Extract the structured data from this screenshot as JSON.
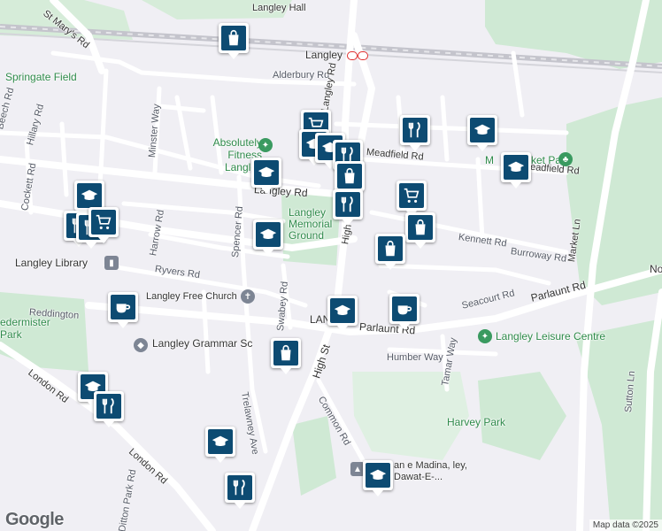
{
  "map": {
    "labels": {
      "langley_hall": "Langley Hall",
      "st_marys_rd": "St Mary's Rd",
      "langley_station": "Langley",
      "alderbury_rd": "Alderbury Rd",
      "springate_field": "Springate Field",
      "beech_rd": "Beech Rd",
      "hillary_rd": "Hillary Rd",
      "minster_way": "Minster Way",
      "langley_rd_v": "Langley Rd",
      "absolutely_fitness": "Absolutely Fitness Langley",
      "langley_rd_h": "Langley Rd",
      "cockett_rd": "Cockett Rd",
      "harrow_rd": "Harrow Rd",
      "spencer_rd": "Spencer Rd",
      "langley_memorial": "Langley Memorial Ground",
      "high_st_n": "High",
      "headfield_rd_1": "Meadfield Rd",
      "headfield_rd_2": "Meadfield Rd",
      "market_ln": "Market Ln",
      "kennett_rd": "Kennett Rd",
      "burroway_rd": "Burroway Rd",
      "langley_library": "Langley Library",
      "ryvers_rd": "Ryvers Rd",
      "free_church": "Langley Free Church",
      "swabey_rd": "Swabey Rd",
      "seacourt_rd": "Seacourt Rd",
      "parlaunt_rd": "Parlaunt Rd",
      "parlaunt_rd2": "Parlaunt Rd",
      "no": "No",
      "reddington": "Reddington",
      "upton_park": "edermister Park",
      "langley_grammar": "Langley Grammar Sc",
      "high_st_s": "High St",
      "langley_leisure": "Langley Leisure Centre",
      "humber_way": "Humber Way",
      "tamar_way": "Tamar Way",
      "london_rd_1": "London Rd",
      "london_rd_2": "London Rd",
      "trelawney_ave": "Trelawney Ave",
      "common_rd": "Common Rd",
      "harvey_park": "Harvey Park",
      "sutton_ln": "Sutton Ln",
      "mosque": "an e Madina, ley, Dawat-E-...",
      "ditton_park": "Ditton Park Rd",
      "market_park": "M",
      "market_park2": "ket Park",
      "langley_parlaunt": "LAN"
    },
    "google_logo": "Google",
    "attribution": "Map data ©2025",
    "pins": [
      {
        "icon": "shopping-bag",
        "name": "pin-shopping-1"
      },
      {
        "icon": "shopping-cart",
        "name": "pin-supermarket-1"
      },
      {
        "icon": "cutlery",
        "name": "pin-restaurant-1"
      },
      {
        "icon": "graduation-cap",
        "name": "pin-school-1"
      },
      {
        "icon": "graduation-cap",
        "name": "pin-school-2"
      },
      {
        "icon": "graduation-cap",
        "name": "pin-school-3"
      },
      {
        "icon": "graduation-cap",
        "name": "pin-school-4"
      },
      {
        "icon": "cutlery",
        "name": "pin-restaurant-2"
      },
      {
        "icon": "shopping-cart",
        "name": "pin-supermarket-2"
      },
      {
        "icon": "shopping-bag",
        "name": "pin-shopping-2"
      },
      {
        "icon": "shopping-bag",
        "name": "pin-shopping-3"
      },
      {
        "icon": "graduation-cap",
        "name": "pin-school-5"
      },
      {
        "icon": "graduation-cap",
        "name": "pin-school-6"
      },
      {
        "icon": "graduation-cap",
        "name": "pin-school-7"
      },
      {
        "icon": "coffee-cup",
        "name": "pin-cafe-1"
      },
      {
        "icon": "coffee-cup",
        "name": "pin-cafe-2"
      },
      {
        "icon": "shopping-bag",
        "name": "pin-shopping-4"
      },
      {
        "icon": "graduation-cap",
        "name": "pin-school-8"
      },
      {
        "icon": "cutlery",
        "name": "pin-restaurant-3"
      },
      {
        "icon": "shopping-bag",
        "name": "pin-shopping-5"
      },
      {
        "icon": "graduation-cap",
        "name": "pin-school-9"
      },
      {
        "icon": "cutlery",
        "name": "pin-restaurant-4"
      },
      {
        "icon": "cutlery",
        "name": "pin-restaurant-5"
      },
      {
        "icon": "graduation-cap",
        "name": "pin-school-10"
      },
      {
        "icon": "cutlery",
        "name": "pin-restaurant-6"
      },
      {
        "icon": "cutlery",
        "name": "pin-restaurant-7"
      },
      {
        "icon": "shopping-cart",
        "name": "pin-supermarket-3"
      },
      {
        "icon": "graduation-cap",
        "name": "pin-school-11"
      }
    ],
    "colors": {
      "background": "#f0eff4",
      "park": "#c9e8cf",
      "road_major": "#ffffff",
      "pin": "#0d4b72"
    }
  }
}
